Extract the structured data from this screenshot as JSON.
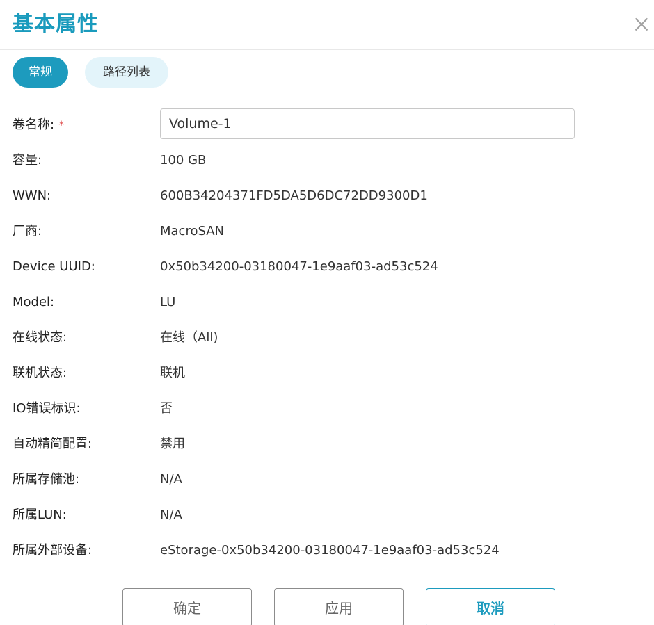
{
  "dialog": {
    "title": "基本属性"
  },
  "tabs": [
    {
      "label": "常规"
    },
    {
      "label": "路径列表"
    }
  ],
  "form": {
    "volume_name": {
      "label": "卷名称:",
      "required_mark": "*",
      "value": "Volume-1"
    },
    "rows": [
      {
        "label": "容量:",
        "value": "100 GB"
      },
      {
        "label": "WWN:",
        "value": "600B34204371FD5DA5D6DC72DD9300D1"
      },
      {
        "label": "厂商:",
        "value": "MacroSAN"
      },
      {
        "label": "Device UUID:",
        "value": "0x50b34200-03180047-1e9aaf03-ad53c524"
      },
      {
        "label": "Model:",
        "value": "LU"
      },
      {
        "label": "在线状态:",
        "value": "在线（All)"
      },
      {
        "label": "联机状态:",
        "value": "联机"
      },
      {
        "label": "IO错误标识:",
        "value": "否"
      },
      {
        "label": "自动精简配置:",
        "value": "禁用"
      },
      {
        "label": "所属存储池:",
        "value": "N/A"
      },
      {
        "label": "所属LUN:",
        "value": "N/A"
      },
      {
        "label": "所属外部设备:",
        "value": "eStorage-0x50b34200-03180047-1e9aaf03-ad53c524"
      }
    ]
  },
  "buttons": {
    "ok": "确定",
    "apply": "应用",
    "cancel": "取消"
  },
  "colors": {
    "accent": "#1d9bbe",
    "tab_inactive_bg": "#e3f4fa",
    "required": "#e05050"
  },
  "icons": {
    "close": "close-icon"
  }
}
